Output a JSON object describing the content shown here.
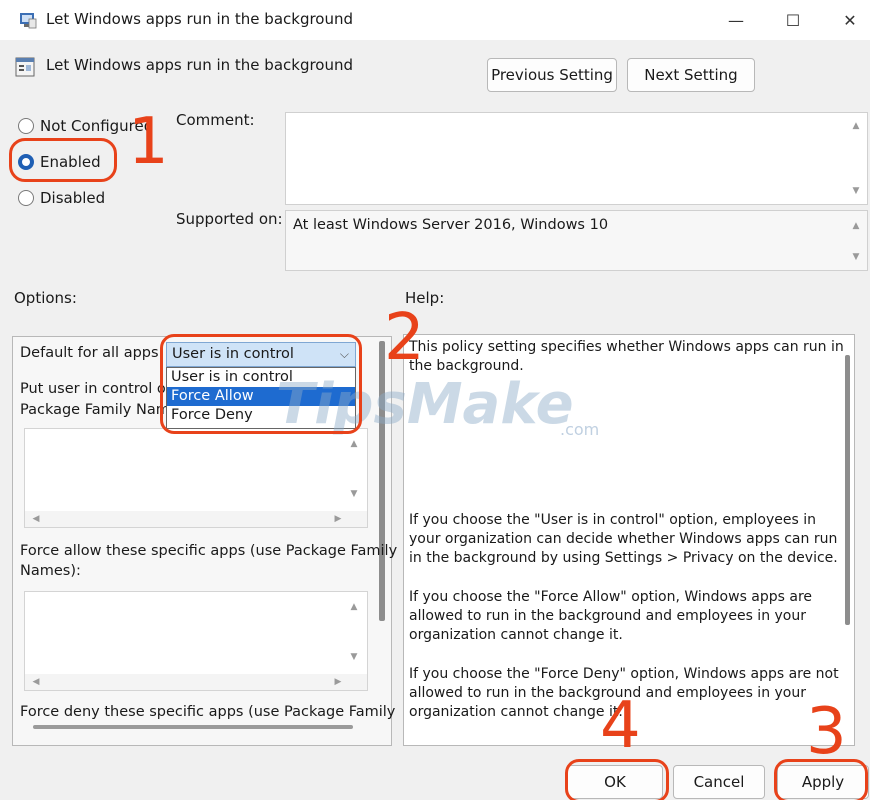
{
  "window": {
    "title": "Let Windows apps run in the background",
    "minimize_glyph": "—",
    "maximize_glyph": "☐",
    "close_glyph": "✕"
  },
  "setting": {
    "name": "Let Windows apps run in the background",
    "prev_button": "Previous Setting",
    "next_button": "Next Setting"
  },
  "state_radios": [
    {
      "label": "Not Configured",
      "checked": false
    },
    {
      "label": "Enabled",
      "checked": true
    },
    {
      "label": "Disabled",
      "checked": false
    }
  ],
  "comment": {
    "label": "Comment:",
    "value": ""
  },
  "supported_on": {
    "label": "Supported on:",
    "value": "At least Windows Server 2016, Windows 10"
  },
  "options": {
    "label": "Options:",
    "default_label": "Default for all apps:",
    "dropdown_value": "User is in control",
    "dropdown_options": [
      "User is in control",
      "Force Allow",
      "Force Deny"
    ],
    "dropdown_highlighted": "Force Allow",
    "user_in_control_label_1": "Put user in control of",
    "user_in_control_label_2": "Package Family Nam",
    "force_allow_label_1": "Force allow these specific apps (use Package Family",
    "force_allow_label_2": "Names):",
    "force_deny_label": "Force deny these specific apps (use Package Family"
  },
  "help": {
    "label": "Help:",
    "paragraphs": [
      "This policy setting specifies whether Windows apps can run in the background.",
      "If you choose the \"User is in control\" option, employees in your organization can decide whether Windows apps can run in the background by using Settings > Privacy on the device.",
      "If you choose the \"Force Allow\" option, Windows apps are allowed to run in the background and employees in your organization cannot change it.",
      "If you choose the \"Force Deny\" option, Windows apps are not allowed to run in the background and employees in your organization cannot change it."
    ]
  },
  "footer": {
    "ok": "OK",
    "cancel": "Cancel",
    "apply": "Apply"
  },
  "annotations": {
    "step1": "1",
    "step2": "2",
    "step3": "3",
    "step4": "4"
  },
  "watermark": {
    "text": "TipsMake",
    "suffix": ".com"
  },
  "colors": {
    "callout": "#e8421a",
    "accent": "#1f5fb4",
    "selection": "#1e6bd0"
  }
}
